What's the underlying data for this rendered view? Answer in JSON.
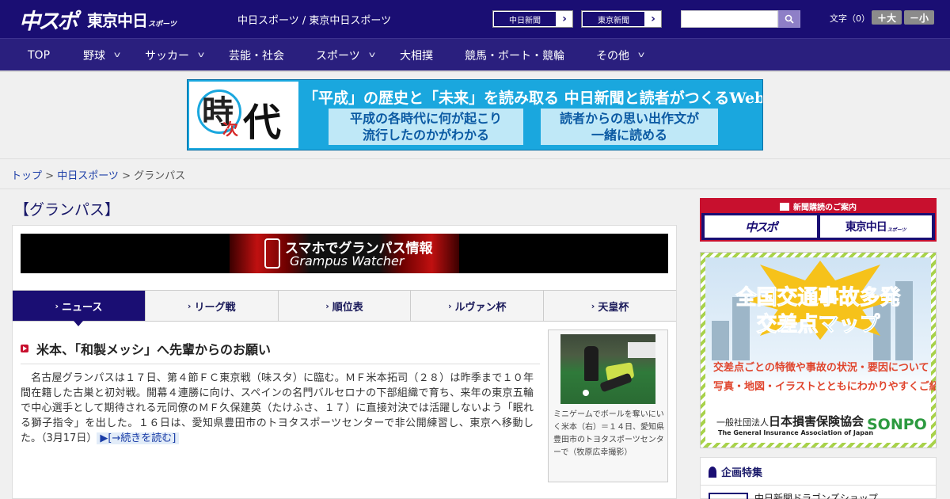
{
  "header": {
    "logo_main": "中スポ",
    "logo_sub": "東京中日",
    "logo_tag": "スポーツ",
    "site_title": "中日スポーツ / 東京中日スポーツ",
    "ext_links": [
      "中日新聞",
      "東京新聞"
    ],
    "search_placeholder": "",
    "font_label": "文字（0）",
    "font_bigger": "＋大",
    "font_smaller": "－小"
  },
  "nav": {
    "items": [
      {
        "label": "TOP"
      },
      {
        "label": "野球"
      },
      {
        "label": "サッカー"
      },
      {
        "label": "芸能・社会"
      },
      {
        "label": "スポーツ"
      },
      {
        "label": "大相撲"
      },
      {
        "label": "競馬・ボート・競輪"
      },
      {
        "label": "その他"
      }
    ]
  },
  "banner": {
    "char1": "時",
    "char2": "次",
    "char3": "代",
    "headline": "「平成」の歴史と「未来」を読み取る 中日新聞と読者がつくるWebサイト",
    "sub_left_1": "平成の各時代に何が起こり",
    "sub_left_2": "流行したのかがわかる",
    "sub_right_1": "読者からの思い出作文が",
    "sub_right_2": "一緒に読める"
  },
  "breadcrumb": {
    "top": "トップ",
    "sep": " > ",
    "section": "中日スポーツ",
    "current": "グランパス"
  },
  "page": {
    "heading": "【グランパス】"
  },
  "app_banner": {
    "line1": "スマホでグランパス情報",
    "line2": "Grampus Watcher"
  },
  "tabs": [
    {
      "label": "ニュース",
      "active": true
    },
    {
      "label": "リーグ戦",
      "active": false
    },
    {
      "label": "順位表",
      "active": false
    },
    {
      "label": "ルヴァン杯",
      "active": false
    },
    {
      "label": "天皇杯",
      "active": false
    }
  ],
  "article": {
    "title": "米本、「和製メッシ」へ先輩からのお願い",
    "body": "名古屋グランパスは１７日、第４節ＦＣ東京戦（味スタ）に臨む。ＭＦ米本拓司（２８）は昨季まで１０年間在籍した古巣と初対戦。開幕４連勝に向け、スペインの名門バルセロナの下部組織で育ち、来年の東京五輪で中心選手として期待される元同僚のＭＦ久保建英（たけふさ、１７）に直接対決では活躍しないよう「眠れる獅子指令」を出した。１６日は、愛知県豊田市のトヨタスポーツセンターで非公開練習し、東京へ移動した。",
    "date": "（3月17日）",
    "more": "▶[→続きを読む]",
    "photo_caption": "ミニゲームでボールを奪いにいく米本（右）＝１４日、愛知県豊田市のトヨタスポーツセンターで（牧原広幸撮影）"
  },
  "sidebar": {
    "subscription_head": "新聞購読のご案内",
    "sub_logo_1": "中スポ",
    "sub_logo_2": "東京中日",
    "sub_logo_2_tag": "スポーツ",
    "ad_title_1": "全国交通事故多発",
    "ad_title_2": "交差点マップ",
    "ad_desc_1": "交差点ごとの特徴や事故の状況・要因について",
    "ad_desc_2": "写真・地図・イラストとともにわかりやすくご紹介!",
    "ad_org_prefix": "一般社団法人",
    "ad_org": "日本損害保険協会",
    "ad_org_en": "The General Insurance Association of Japan",
    "ad_brand": "SONPO",
    "feature_title": "企画特集",
    "feature_item": "中日新聞ドラゴンズショップ"
  },
  "colors": {
    "brand_navy": "#1a0e73",
    "nav_bg": "#2a1f7e",
    "accent_red": "#c8102e",
    "banner_blue": "#1aa7de"
  }
}
